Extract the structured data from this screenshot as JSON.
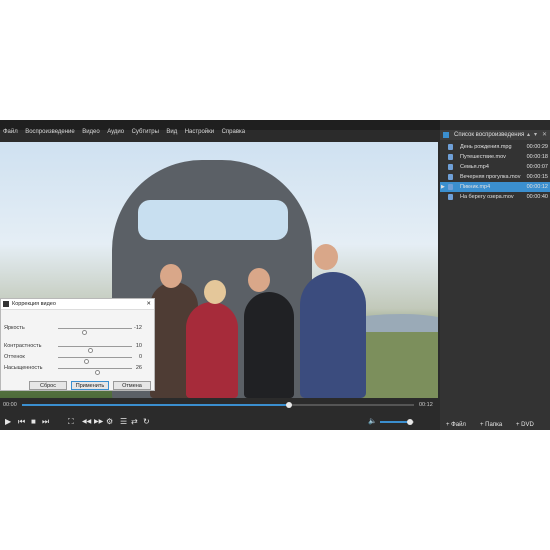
{
  "menu": [
    "Файл",
    "Воспроизведение",
    "Видео",
    "Аудио",
    "Субтитры",
    "Вид",
    "Настройки",
    "Справка"
  ],
  "playlist": {
    "title": "Список воспроизведения",
    "controls": [
      "▴",
      "▾",
      "✕"
    ],
    "items": [
      {
        "name": "День рождения.mpg",
        "time": "00:00:29",
        "active": false
      },
      {
        "name": "Путешествие.mov",
        "time": "00:00:18",
        "active": false
      },
      {
        "name": "Семья.mp4",
        "time": "00:00:07",
        "active": false
      },
      {
        "name": "Вечерняя прогулка.mov",
        "time": "00:00:15",
        "active": false
      },
      {
        "name": "Пикник.mp4",
        "time": "00:00:12",
        "active": true
      },
      {
        "name": "На берегу озера.mov",
        "time": "00:00:40",
        "active": false
      }
    ],
    "buttons": {
      "file": "+ Файл",
      "folder": "+ Папка",
      "dvd": "+ DVD"
    }
  },
  "timeline": {
    "current": "00:00",
    "total": "00:12",
    "progress": 0.68
  },
  "volume": {
    "level": 0.88
  },
  "dialog": {
    "title": "Коррекция видео",
    "icon": "film-adjust-icon",
    "close": "✕",
    "rows": [
      {
        "label": "Яркость",
        "value": "-12",
        "pos": 0.36
      },
      {
        "label": "Контрастность",
        "value": "10",
        "pos": 0.44
      },
      {
        "label": "Оттенок",
        "value": "0",
        "pos": 0.38
      },
      {
        "label": "Насыщенность",
        "value": "26",
        "pos": 0.53
      }
    ],
    "buttons": {
      "reset": "Сброс",
      "apply": "Применить",
      "cancel": "Отмена"
    }
  },
  "player_controls": {
    "play": "▶",
    "prev": "⏮",
    "stop": "■",
    "next": "⏭",
    "fullscreen": "⛶",
    "rewind": "◀◀",
    "forward": "▶▶",
    "snapshot": "⚙",
    "playlist": "☰",
    "shuffle": "⇄",
    "repeat": "↻",
    "volume": "🔈"
  },
  "colors": {
    "accent": "#3b8fcf",
    "panel": "#2b2b2b",
    "sidebar": "#333333"
  }
}
